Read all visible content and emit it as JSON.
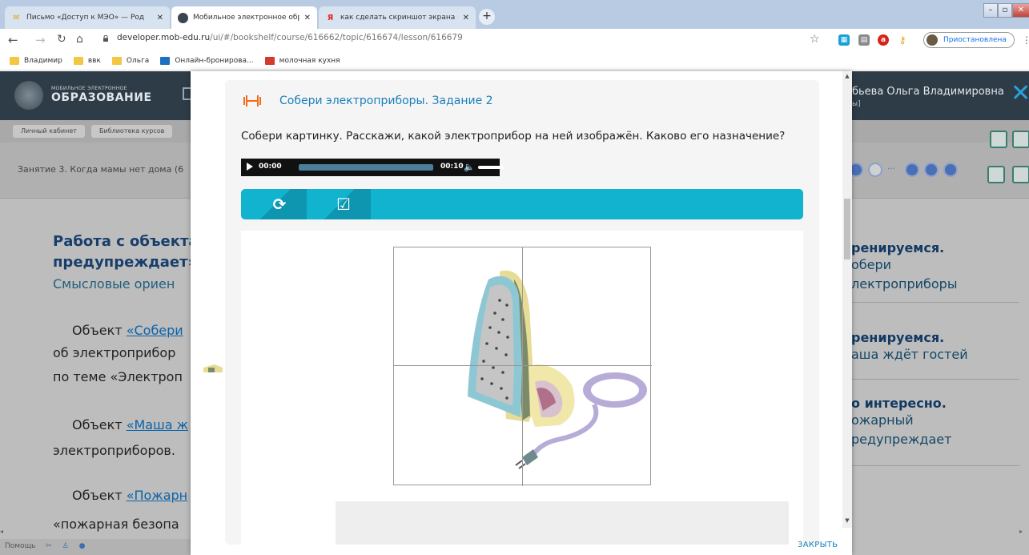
{
  "browser": {
    "tabs": [
      {
        "title": "Письмо «Доступ к МЭО» — Род",
        "active": false
      },
      {
        "title": "Мобильное электронное образ",
        "active": true
      },
      {
        "title": "как сделать скриншот экрана н",
        "active": false
      }
    ],
    "new_tab": "+",
    "url_host": "developer.mob-edu.ru",
    "url_path": "/ui/#/bookshelf/course/616662/topic/616674/lesson/616679",
    "profile_status": "Приостановлена",
    "bookmarks": [
      {
        "label": "Владимир",
        "color": "#f2c744"
      },
      {
        "label": "ввк",
        "color": "#f2c744"
      },
      {
        "label": "Ольга",
        "color": "#f2c744"
      },
      {
        "label": "Онлайн-бронирова...",
        "color": "#1e6fc2"
      },
      {
        "label": "молочная кухня",
        "color": "#d13b2c"
      }
    ]
  },
  "site": {
    "brand_top": "МОБИЛЬНОЕ ЭЛЕКТРОННОЕ",
    "brand": "ОБРАЗОВАНИЕ",
    "user_name": "бьева Ольга Владимировна",
    "user_sub": "ы]",
    "breadcrumbs": [
      "Личный кабинет",
      "Библиотека курсов"
    ],
    "lesson_title": "Занятие 3. Когда мамы нет дома (6",
    "pager_more": "...",
    "left": {
      "heading_1": "Работа с объекта",
      "heading_2": "предупреждает»",
      "subheading": "Смысловые ориен",
      "p1_prefix": "Объект ",
      "p1_link": "«Собери",
      "p1_line2": "об электроприбор",
      "p1_line3": "по теме «Электроп",
      "p2_prefix": "Объект ",
      "p2_link": "«Маша ж",
      "p2_line2": "электроприборов.",
      "p3_prefix": "Объект ",
      "p3_link": "«Пожарн",
      "p3_line2": "«пожарная безопа"
    },
    "right_list": [
      {
        "title": "ренируемся.",
        "sub1": "обери",
        "sub2": "лектроприборы"
      },
      {
        "title": "ренируемся.",
        "sub1": "аша ждёт гостей",
        "sub2": ""
      },
      {
        "title": "о интересно.",
        "sub1": "ожарный",
        "sub2": "редупреждает"
      }
    ],
    "footer_help": "Помощь"
  },
  "modal": {
    "task_title": "Собери электроприборы. Задание 2",
    "question": "Собери картинку. Расскажи, какой электроприбор на ней изображён. Каково его назначение?",
    "audio": {
      "current": "00:00",
      "duration": "00:10",
      "progress": 1.0
    },
    "toolbar": [
      {
        "icon": "refresh-icon",
        "glyph": "⟳"
      },
      {
        "icon": "check-box-icon",
        "glyph": "☑"
      }
    ],
    "close_label": "ЗАКРЫТЬ",
    "accent": "#12b3cf",
    "title_color": "#1a7fbd"
  }
}
